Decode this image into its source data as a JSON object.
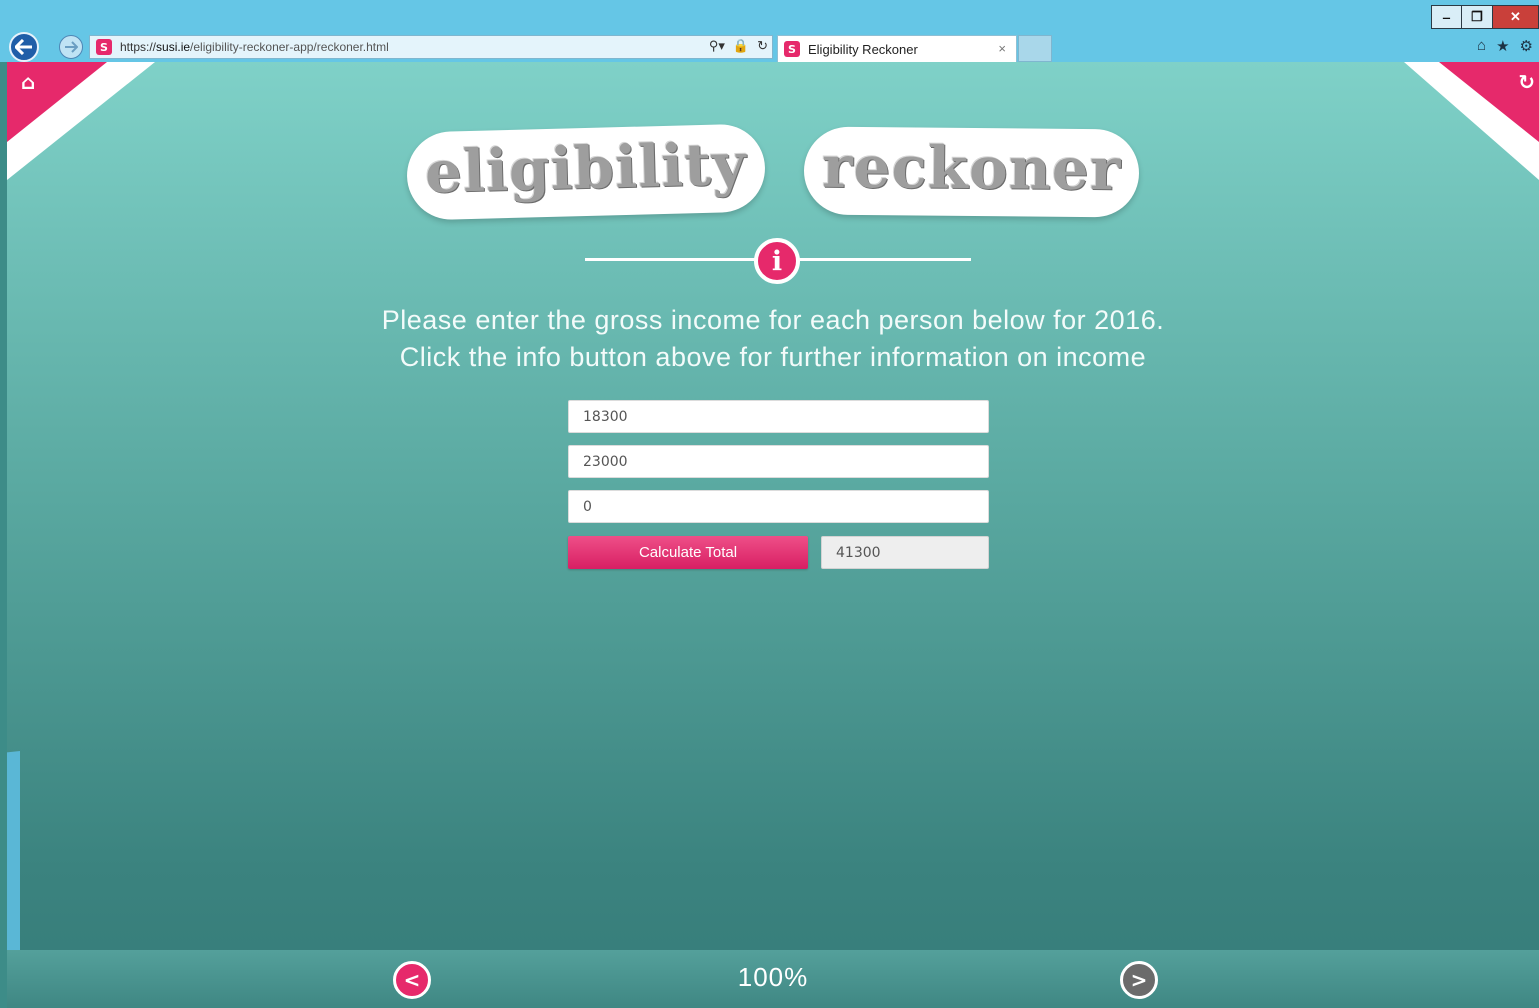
{
  "browser": {
    "window_controls": {
      "minimize": "‒",
      "restore": "❐",
      "close": "✕"
    },
    "address": {
      "favicon": "S",
      "url_scheme": "https://",
      "url_host": "susi.ie",
      "url_path": "/eligibility-reckoner-app/reckoner.html",
      "tools": {
        "search": "⚲▾",
        "lock": "🔒",
        "refresh": "↻"
      }
    },
    "tab": {
      "favicon": "S",
      "title": "Eligibility Reckoner",
      "close": "×"
    },
    "icons": {
      "home": "⌂",
      "favorites": "★",
      "settings": "⚙"
    }
  },
  "page": {
    "corner_left_icon": "⌂",
    "corner_right_icon": "↻",
    "logo": {
      "word1": "eligibility",
      "word2": "reckoner"
    },
    "info_button": "i",
    "instructions": {
      "line1": "Please enter the gross income for each person below for 2016.",
      "line2": "Click the info button above for further information on income"
    },
    "income_fields": [
      "18300",
      "23000",
      "0"
    ],
    "calculate_label": "Calculate Total",
    "total_value": "41300",
    "accent_color": "#e6296b"
  },
  "footer": {
    "prev": "<",
    "progress": "100%",
    "next": ">"
  }
}
